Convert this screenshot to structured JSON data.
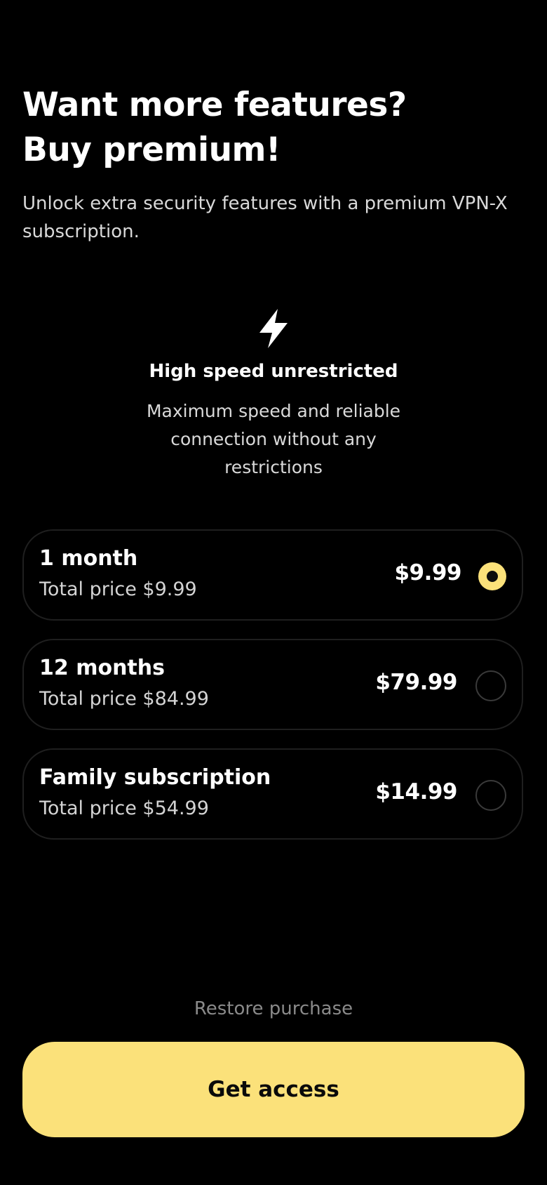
{
  "header": {
    "title_line1": "Want more features?",
    "title_line2": "Buy premium!",
    "subtitle": "Unlock extra security features with a premium VPN-X subscription."
  },
  "feature": {
    "icon": "lightning-bolt-icon",
    "title": "High speed unrestricted",
    "description": "Maximum speed and reliable connection without any restrictions"
  },
  "plans": [
    {
      "name": "1 month",
      "total": "Total price $9.99",
      "price": "$9.99",
      "selected": true
    },
    {
      "name": "12 months",
      "total": "Total price $84.99",
      "price": "$79.99",
      "selected": false
    },
    {
      "name": "Family subscription",
      "total": "Total price $54.99",
      "price": "$14.99",
      "selected": false
    }
  ],
  "restore_label": "Restore purchase",
  "cta_label": "Get access",
  "colors": {
    "background": "#000000",
    "accent": "#fbe17a",
    "text": "#ffffff",
    "muted": "#8a8a8a"
  }
}
